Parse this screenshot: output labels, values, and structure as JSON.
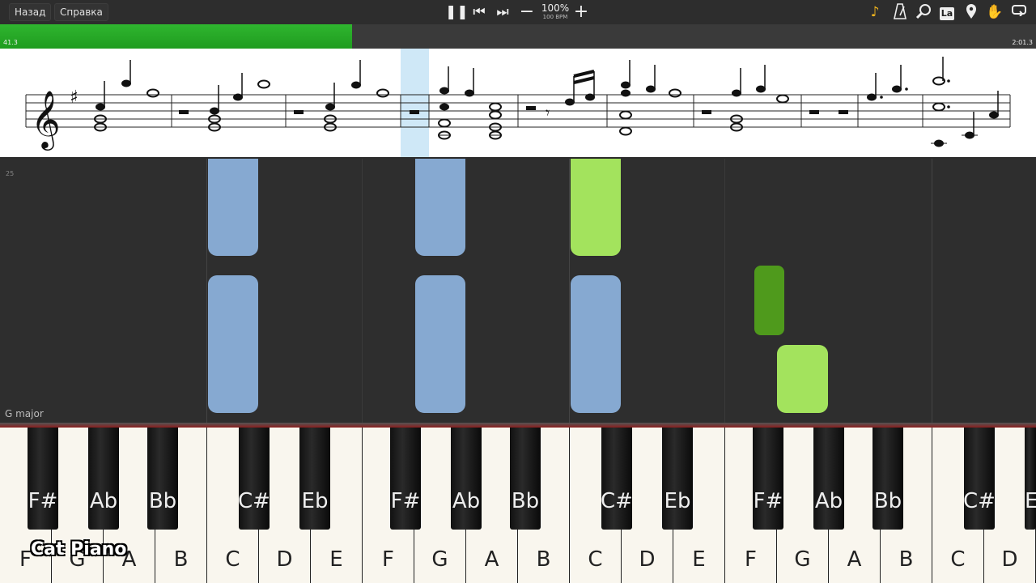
{
  "toolbar": {
    "back_label": "Назад",
    "help_label": "Справка",
    "zoom_percent": "100%",
    "tempo": "100 BPM",
    "icons": [
      "pause-icon",
      "skip-back-icon",
      "skip-forward-icon",
      "minus-icon",
      "plus-icon",
      "note-icon",
      "metronome-icon",
      "magnifier-icon",
      "la-icon",
      "pin-icon",
      "hand-icon",
      "loop-icon"
    ],
    "la_label": "La"
  },
  "progress": {
    "start_time": "41.3",
    "end_time": "2:01.3",
    "played_fraction": 0.34,
    "fill_color": "#24a824"
  },
  "piano_roll": {
    "measure_number": "25",
    "key_signature": "G major",
    "colors": {
      "left_hand": "#86a9d1",
      "right_hand_light": "#a3e35d",
      "right_hand_dark": "#4f9a1c"
    }
  },
  "keyboard": {
    "white_keys": [
      "F",
      "G",
      "A",
      "B",
      "C",
      "D",
      "E",
      "F",
      "G",
      "A",
      "B",
      "C",
      "D",
      "E",
      "F",
      "G",
      "A",
      "B",
      "C",
      "D"
    ],
    "black_keys": [
      "F#",
      "Ab",
      "Bb",
      "C#",
      "Eb",
      "F#",
      "Ab",
      "Bb",
      "C#",
      "Eb",
      "F#",
      "Ab",
      "Bb",
      "C#",
      "E"
    ]
  },
  "branding": {
    "watermark": "Cat Piano"
  }
}
